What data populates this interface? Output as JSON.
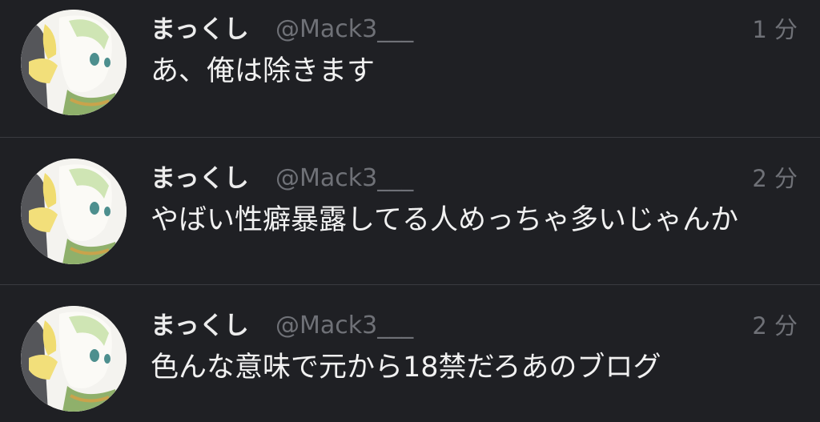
{
  "tweets": [
    {
      "name": "まっくし",
      "handle": "@Mack3___",
      "time": "1 分",
      "text": "あ、俺は除きます"
    },
    {
      "name": "まっくし",
      "handle": "@Mack3___",
      "time": "2 分",
      "text": "やばい性癖暴露してる人めっちゃ多いじゃんか"
    },
    {
      "name": "まっくし",
      "handle": "@Mack3___",
      "time": "2 分",
      "text": "色んな意味で元から18禁だろあのブログ"
    }
  ],
  "colors": {
    "background": "#1f2024",
    "divider": "#3a3b40",
    "name": "#ececec",
    "meta": "#6f7177",
    "text": "#f1f1f1"
  },
  "icons": {
    "avatar": "avatar-anime-character"
  }
}
